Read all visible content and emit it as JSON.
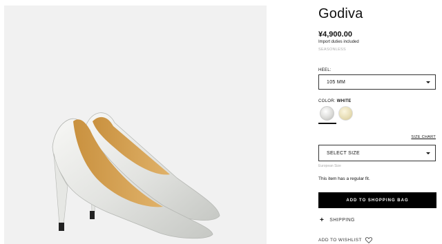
{
  "product": {
    "title": "Godiva",
    "price": "¥4,900.00",
    "duties_note": "Import duties included",
    "season": "SEASONLESS"
  },
  "heel": {
    "label": "HEEL:",
    "selected": "105 MM"
  },
  "color": {
    "label": "COLOR:",
    "selected": "WHITE",
    "swatches": [
      {
        "name": "white",
        "color": "#e8e8e6"
      },
      {
        "name": "cream",
        "color": "#e6dcb3"
      }
    ]
  },
  "size": {
    "chart_link": "SIZE CHART",
    "placeholder": "SELECT SIZE",
    "system_note": "European Size",
    "fit_note": "This item has a regular fit."
  },
  "actions": {
    "add_to_bag": "ADD TO SHOPPING BAG",
    "shipping": "SHIPPING",
    "wishlist": "ADD TO WISHLIST"
  },
  "image": {
    "background": "#f1f1f1"
  }
}
